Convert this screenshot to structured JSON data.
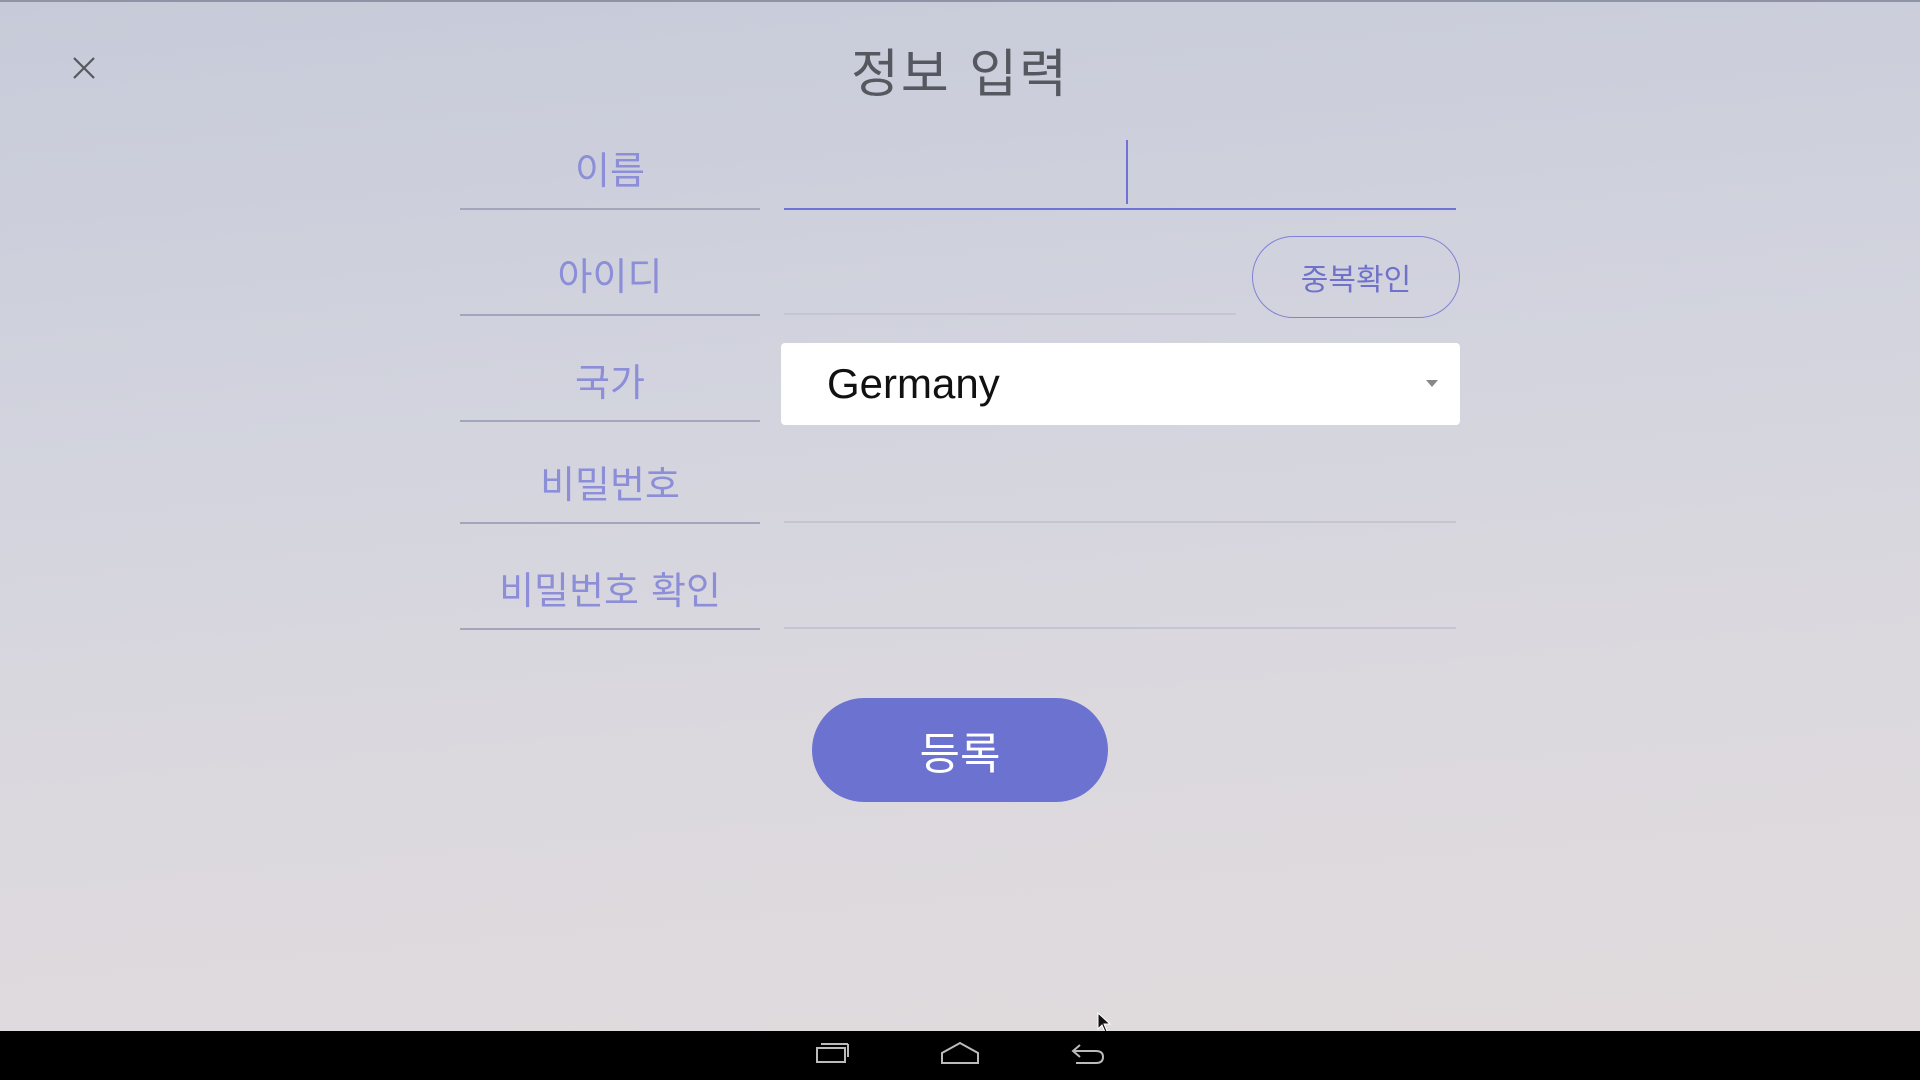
{
  "header": {
    "title": "정보 입력",
    "close_icon": "close-icon"
  },
  "form": {
    "name_label": "이름",
    "name_value": "",
    "id_label": "아이디",
    "id_value": "",
    "dup_check_label": "중복확인",
    "country_label": "국가",
    "country_value": "Germany",
    "password_label": "비밀번호",
    "password_value": "",
    "password_confirm_label": "비밀번호 확인",
    "password_confirm_value": "",
    "submit_label": "등록"
  },
  "colors": {
    "accent": "#6c72cf",
    "label": "#8c8ed8",
    "title": "#55585f"
  },
  "navbar": {
    "icons": [
      "recent-apps-icon",
      "home-icon",
      "back-icon"
    ]
  }
}
